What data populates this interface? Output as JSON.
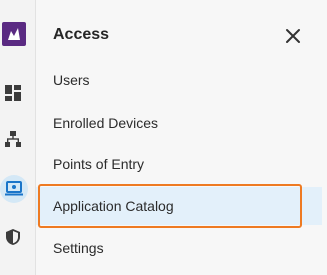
{
  "sidebar": {
    "icons": [
      "brand-logo",
      "dashboard-icon",
      "network-icon",
      "access-icon",
      "shield-icon"
    ],
    "active_icon": "access-icon"
  },
  "panel": {
    "title": "Access",
    "close_icon": "close-icon",
    "items": [
      {
        "label": "Users"
      },
      {
        "label": "Enrolled Devices"
      },
      {
        "label": "Points of Entry"
      },
      {
        "label": "Application Catalog"
      },
      {
        "label": "Settings"
      }
    ],
    "active_item": "Application Catalog"
  },
  "colors": {
    "brand": "#5a2a82",
    "active_bg": "#e3f0fa",
    "highlight_border": "#ee7a22",
    "icon": "#3c3c3c",
    "access_icon": "#1a75c9"
  }
}
